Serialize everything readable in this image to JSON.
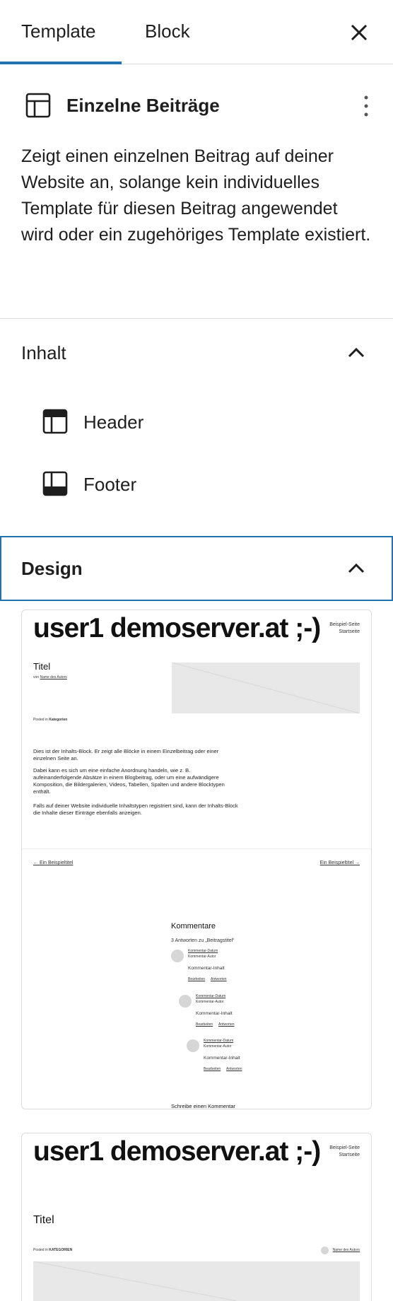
{
  "tabs": {
    "template_label": "Template",
    "block_label": "Block"
  },
  "template": {
    "title": "Einzelne Beiträge",
    "description": "Zeigt einen einzelnen Beitrag auf deiner Website an, solange kein individuelles Template für diesen Beitrag angewendet wird oder ein zugehöriges Template existiert."
  },
  "content_panel": {
    "label": "Inhalt",
    "items": [
      {
        "label": "Header",
        "icon": "header-part-icon"
      },
      {
        "label": "Footer",
        "icon": "footer-part-icon"
      }
    ]
  },
  "design_panel": {
    "label": "Design"
  },
  "preview1": {
    "site_title": "user1 demoserver.at ;-)",
    "nav": [
      "Beispiel-Seite",
      "Startseite"
    ],
    "post_title": "Titel",
    "byline_prefix": "von",
    "byline_author": "Name des Autors",
    "posted_in": "Posted in",
    "categories": "Kategorien",
    "para1": "Dies ist der Inhalts-Block. Er zeigt alle Blöcke in einem Einzelbeitrag oder einer einzelnen Seite an.",
    "para2": "Dabei kann es sich um eine einfache Anordnung handeln, wie z. B. aufeinanderfolgende Absätze in einem Blogbeitrag, oder um eine aufwändigere Komposition, die Bildergalerien, Videos, Tabellen, Spalten und andere Blocktypen enthält.",
    "para3": "Falls auf deiner Website individuelle Inhaltstypen registriert sind, kann der Inhalts-Block die Inhalte dieser Einträge ebenfalls anzeigen.",
    "prev_link": "← Ein Beispieltitel",
    "next_link": "Ein Beispieltitel →",
    "comments_heading": "Kommentare",
    "comments_count": "3 Antworten zu „Beitragstitel“",
    "comment_date": "Kommentar-Datum",
    "comment_author": "Kommentar-Autor",
    "comment_content": "Kommentar-Inhalt",
    "edit_label": "Bearbeiten",
    "reply_label": "Antworten",
    "write_comment": "Schreibe einen Kommentar"
  },
  "preview2": {
    "site_title": "user1 demoserver.at ;-)",
    "nav": [
      "Beispiel-Seite",
      "Startseite"
    ],
    "post_title": "Titel",
    "posted_in": "Posted in",
    "categories": "KATEGORIEN",
    "author": "Name des Autors"
  },
  "colors": {
    "accent": "#2271b1",
    "border": "#dddddd",
    "text": "#1e1e1e"
  }
}
